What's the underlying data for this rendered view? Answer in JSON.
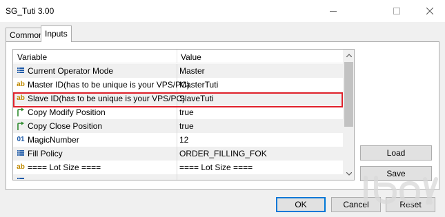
{
  "window": {
    "title": "SG_Tuti 3.00"
  },
  "tabs": [
    {
      "label": "Common",
      "selected": false
    },
    {
      "label": "Inputs",
      "selected": true
    }
  ],
  "grid": {
    "columns": [
      "Variable",
      "Value"
    ],
    "rows": [
      {
        "icon": "list-icon",
        "variable": "Current Operator Mode",
        "value": "Master"
      },
      {
        "icon": "ab-icon",
        "variable": "Master ID(has to be unique is your VPS/PC)",
        "value": "MasterTuti"
      },
      {
        "icon": "ab-icon",
        "variable": "Slave ID(has to be unique is your VPS/PC)",
        "value": "SlaveTuti",
        "highlighted": true
      },
      {
        "icon": "bool-arrow-icon",
        "variable": "Copy Modify Position",
        "value": "true"
      },
      {
        "icon": "bool-arrow-icon",
        "variable": "Copy Close Position",
        "value": "true"
      },
      {
        "icon": "int-01-icon",
        "variable": "MagicNumber",
        "value": "12"
      },
      {
        "icon": "list-icon",
        "variable": "Fill Policy",
        "value": "ORDER_FILLING_FOK"
      },
      {
        "icon": "ab-icon",
        "variable": "==== Lot Size ====",
        "value": "==== Lot Size ===="
      }
    ]
  },
  "buttons": {
    "load": "Load",
    "save": "Save",
    "ok": "OK",
    "cancel": "Cancel",
    "reset": "Reset"
  },
  "colors": {
    "highlight": "#e0212b",
    "alt_row": "#f0f0f0",
    "bool_icon": "#2e8b2e",
    "list_icon": "#1e5aa8"
  }
}
